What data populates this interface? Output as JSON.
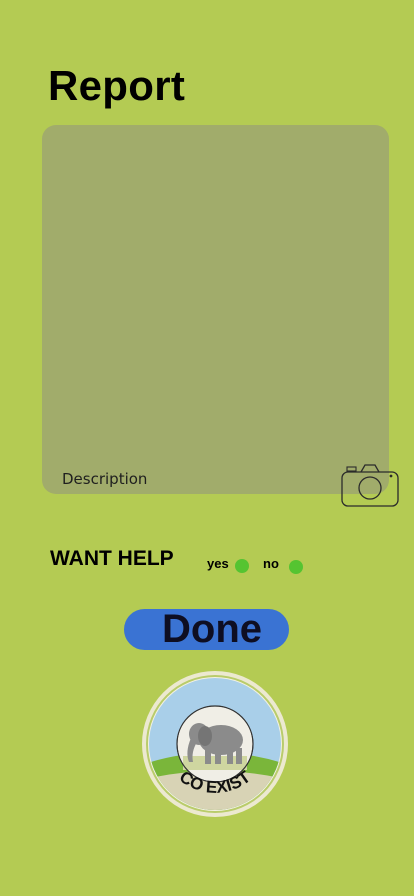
{
  "page": {
    "title": "Report",
    "colors": {
      "background": "#b4cb53",
      "report_box": "#a1ac6b",
      "radio": "#55c431",
      "done_button": "#3a73d3"
    }
  },
  "report": {
    "description_label": "Description",
    "camera_icon": "camera-icon"
  },
  "help": {
    "label": "WANT HELP",
    "options": [
      {
        "label": "yes"
      },
      {
        "label": "no"
      }
    ]
  },
  "actions": {
    "done_label": "Done"
  },
  "logo": {
    "text": "CO EXIST",
    "icon": "elephant-logo"
  }
}
